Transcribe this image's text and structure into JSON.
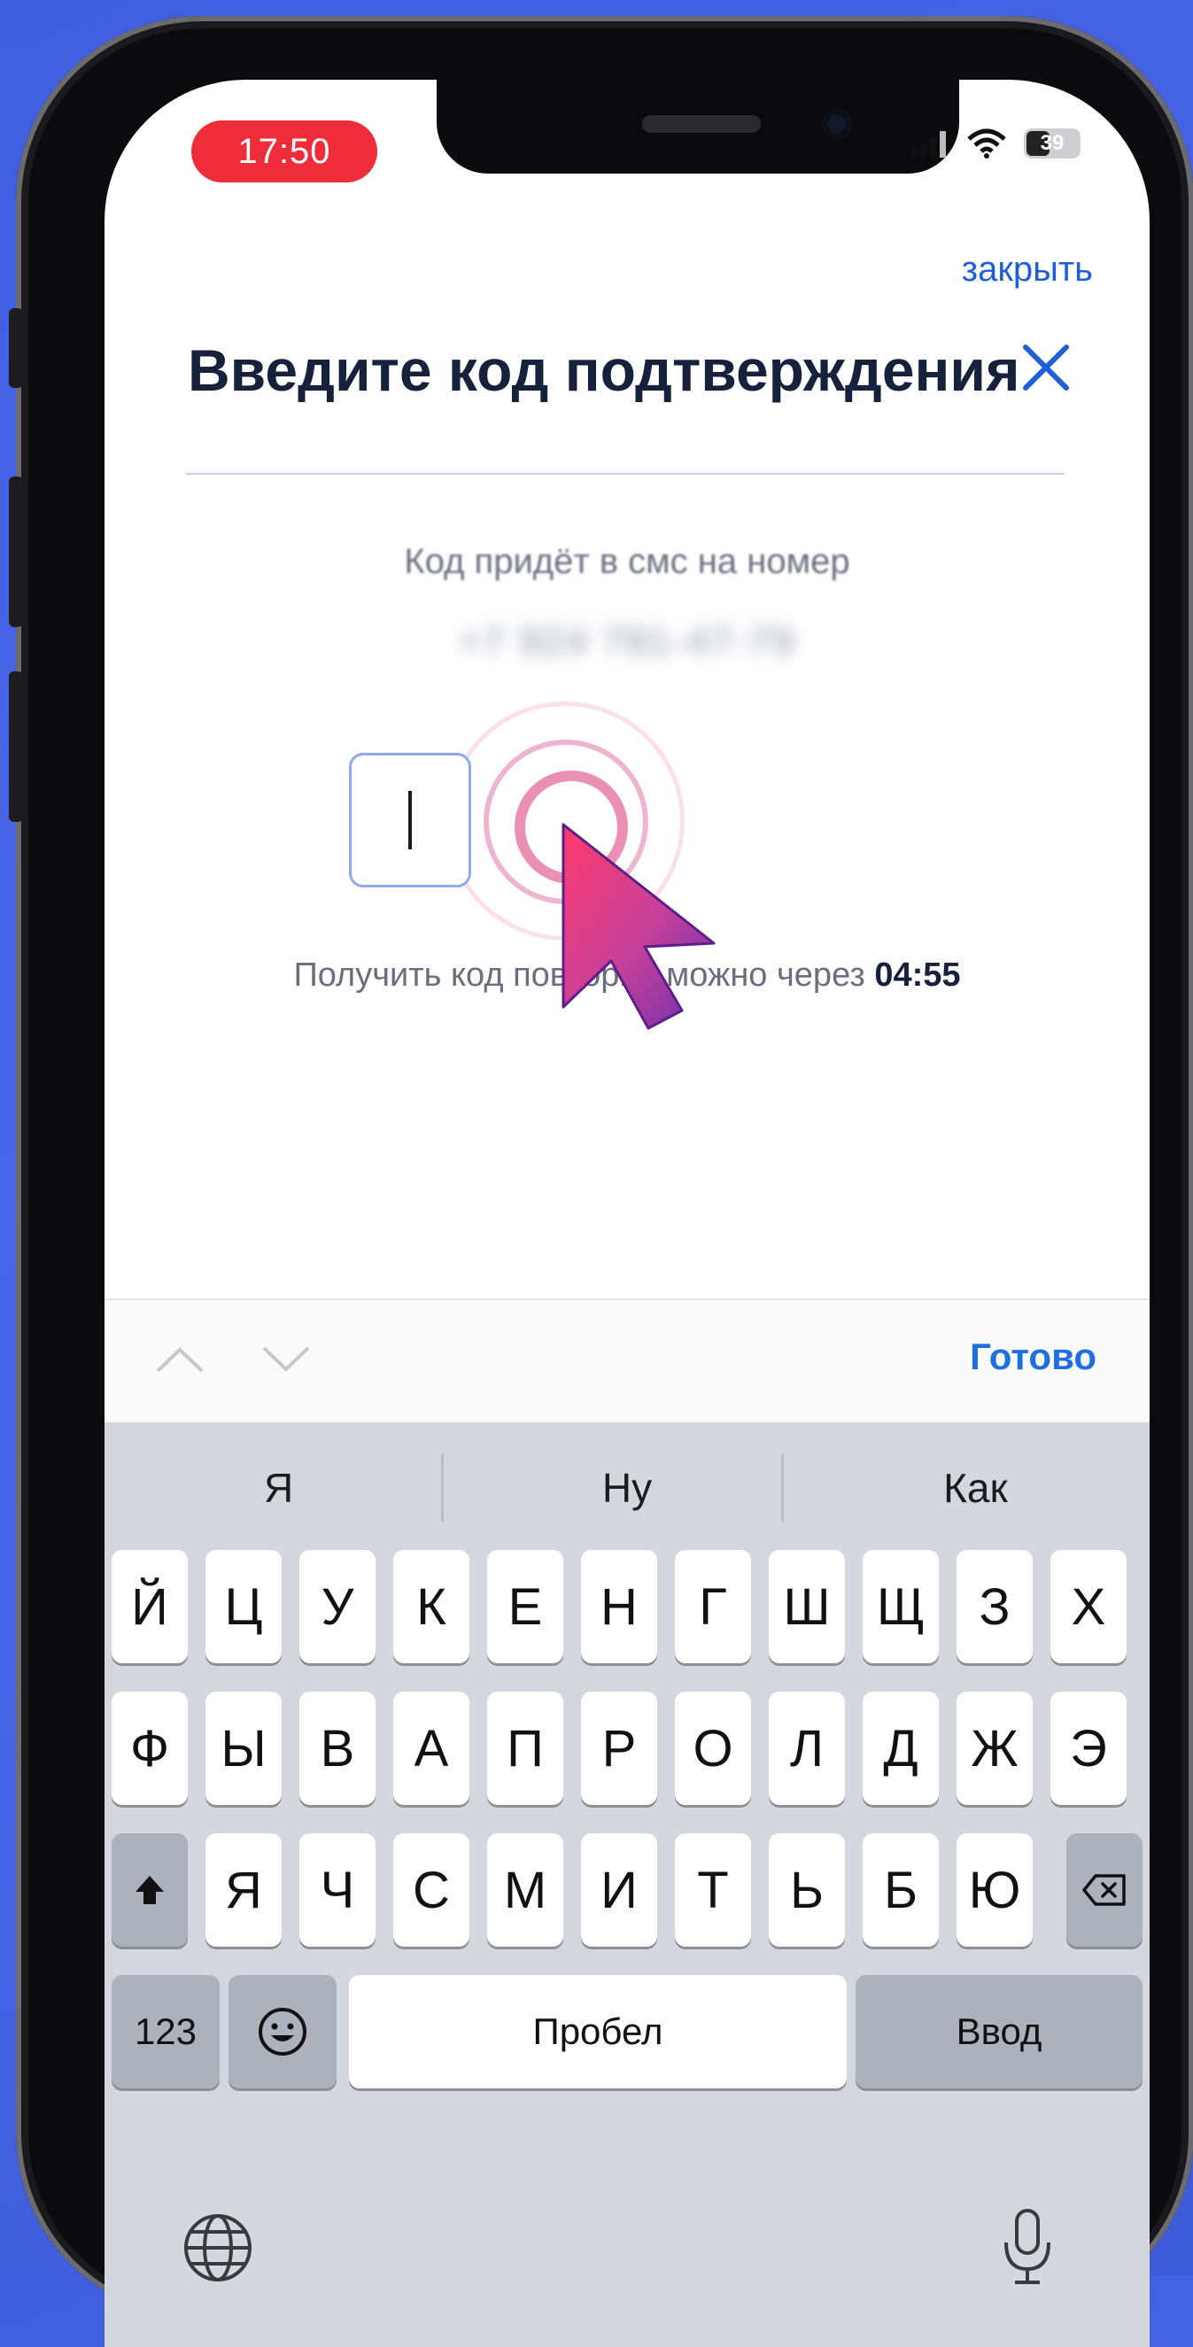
{
  "status_bar": {
    "time": "17:50",
    "battery": "39"
  },
  "header": {
    "close_link": "закрыть",
    "title": "Введите код подтверждения"
  },
  "verification": {
    "sms_label": "Код придёт в смс на номер",
    "phone_number": "+7 924 791-47-79",
    "resend_prefix": "Получить код повторно можно через",
    "resend_timer": "04:55"
  },
  "toolbar": {
    "done_label": "Готово"
  },
  "keyboard": {
    "suggestions": [
      "Я",
      "Ну",
      "Как"
    ],
    "row1": [
      "Й",
      "Ц",
      "У",
      "К",
      "Е",
      "Н",
      "Г",
      "Ш",
      "Щ",
      "З",
      "Х"
    ],
    "row2": [
      "Ф",
      "Ы",
      "В",
      "А",
      "П",
      "Р",
      "О",
      "Л",
      "Д",
      "Ж",
      "Э"
    ],
    "row3": [
      "Я",
      "Ч",
      "С",
      "М",
      "И",
      "Т",
      "Ь",
      "Б",
      "Ю"
    ],
    "numbers_label": "123",
    "space_label": "Пробел",
    "enter_label": "Ввод"
  },
  "icons": {
    "close": "close-icon",
    "caret_up": "chevron-up-icon",
    "caret_down": "chevron-down-icon",
    "shift": "shift-icon",
    "backspace": "backspace-icon",
    "emoji": "emoji-icon",
    "globe": "globe-icon",
    "mic": "microphone-icon"
  },
  "colors": {
    "accent": "#1f5fd6",
    "time_pill": "#ef2d3a",
    "background": "#4a67e8"
  }
}
